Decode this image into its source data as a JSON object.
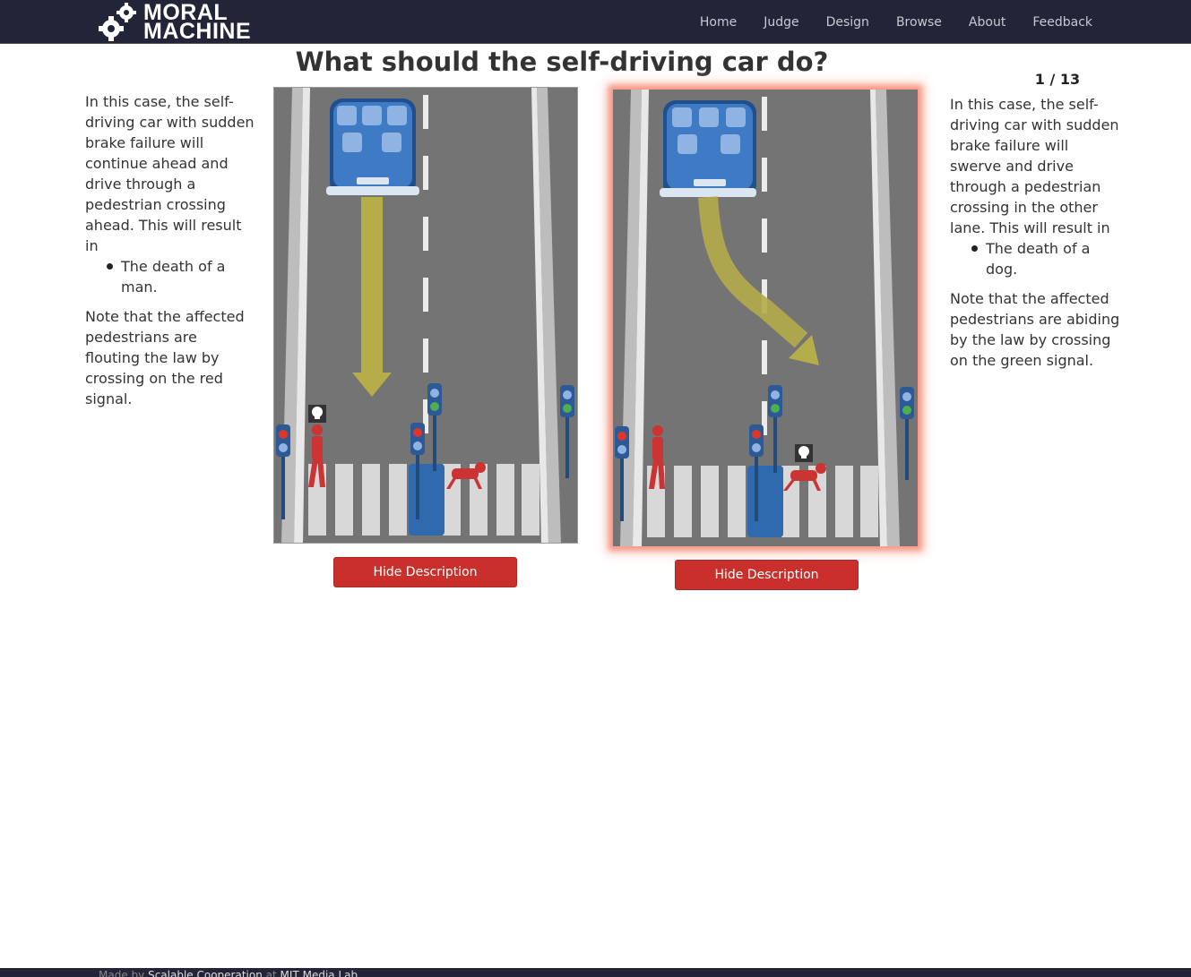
{
  "brand": {
    "line1": "MORAL",
    "line2": "MACHINE"
  },
  "nav": [
    {
      "label": "Home"
    },
    {
      "label": "Judge"
    },
    {
      "label": "Design"
    },
    {
      "label": "Browse"
    },
    {
      "label": "About"
    },
    {
      "label": "Feedback"
    }
  ],
  "question": "What should the self-driving car do?",
  "progress": {
    "label": "1 / 13",
    "current": 1,
    "total": 13
  },
  "left_option": {
    "intro": "In this case, the self-driving car with sudden brake failure will continue ahead and drive through a pedestrian crossing ahead. This will result in",
    "outcomes": [
      "The death of a man."
    ],
    "note": "Note that the affected pedestrians are flouting the law by crossing on the red signal.",
    "button_label": "Hide Description",
    "selected": false
  },
  "right_option": {
    "intro": "In this case, the self-driving car with sudden brake failure will swerve and drive through a pedestrian crossing in the other lane. This will result in",
    "outcomes": [
      "The death of a dog."
    ],
    "note": "Note that the affected pedestrians are abiding by the law by crossing on the green signal.",
    "button_label": "Hide Description",
    "selected": true
  },
  "footer": {
    "prefix": "Made by",
    "org": "Scalable Cooperation",
    "at": "at",
    "lab": "MIT Media Lab"
  },
  "colors": {
    "navbar": "#222437",
    "button": "#c9302c",
    "road": "#747474",
    "arrow": "#b5ac4a",
    "highlight": "#f59a88"
  },
  "icons": [
    "logo-gear-icon",
    "car-icon",
    "arrow-icon",
    "skull-icon",
    "man-icon",
    "dog-icon",
    "traffic-light-icon"
  ]
}
